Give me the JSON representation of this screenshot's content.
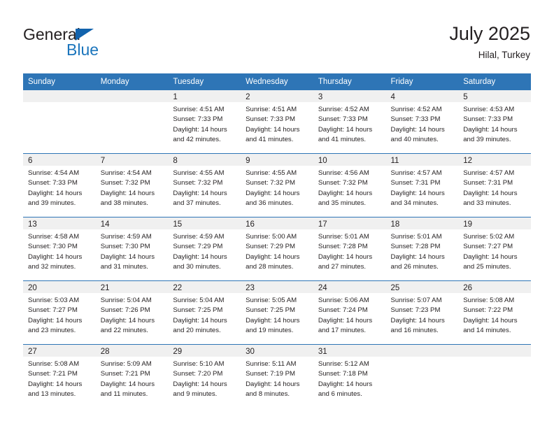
{
  "brand": {
    "line1": "General",
    "line2": "Blue",
    "triangle_color": "#1263ad",
    "blue_color": "#1b75bc"
  },
  "header": {
    "title": "July 2025",
    "location": "Hilal, Turkey"
  },
  "theme": {
    "header_bg": "#2e75b6",
    "header_text": "#ffffff",
    "daynum_bg": "#f0f0f0",
    "text": "#231f20",
    "separator": "#2e75b6"
  },
  "labels": {
    "sunrise": "Sunrise:",
    "sunset": "Sunset:",
    "daylight": "Daylight:"
  },
  "day_headers": [
    "Sunday",
    "Monday",
    "Tuesday",
    "Wednesday",
    "Thursday",
    "Friday",
    "Saturday"
  ],
  "weeks": [
    [
      {
        "day": "",
        "empty": true
      },
      {
        "day": "",
        "empty": true
      },
      {
        "day": "1",
        "sunrise": "Sunrise: 4:51 AM",
        "sunset": "Sunset: 7:33 PM",
        "daylight_l1": "Daylight: 14 hours",
        "daylight_l2": "and 42 minutes."
      },
      {
        "day": "2",
        "sunrise": "Sunrise: 4:51 AM",
        "sunset": "Sunset: 7:33 PM",
        "daylight_l1": "Daylight: 14 hours",
        "daylight_l2": "and 41 minutes."
      },
      {
        "day": "3",
        "sunrise": "Sunrise: 4:52 AM",
        "sunset": "Sunset: 7:33 PM",
        "daylight_l1": "Daylight: 14 hours",
        "daylight_l2": "and 41 minutes."
      },
      {
        "day": "4",
        "sunrise": "Sunrise: 4:52 AM",
        "sunset": "Sunset: 7:33 PM",
        "daylight_l1": "Daylight: 14 hours",
        "daylight_l2": "and 40 minutes."
      },
      {
        "day": "5",
        "sunrise": "Sunrise: 4:53 AM",
        "sunset": "Sunset: 7:33 PM",
        "daylight_l1": "Daylight: 14 hours",
        "daylight_l2": "and 39 minutes."
      }
    ],
    [
      {
        "day": "6",
        "sunrise": "Sunrise: 4:54 AM",
        "sunset": "Sunset: 7:33 PM",
        "daylight_l1": "Daylight: 14 hours",
        "daylight_l2": "and 39 minutes."
      },
      {
        "day": "7",
        "sunrise": "Sunrise: 4:54 AM",
        "sunset": "Sunset: 7:32 PM",
        "daylight_l1": "Daylight: 14 hours",
        "daylight_l2": "and 38 minutes."
      },
      {
        "day": "8",
        "sunrise": "Sunrise: 4:55 AM",
        "sunset": "Sunset: 7:32 PM",
        "daylight_l1": "Daylight: 14 hours",
        "daylight_l2": "and 37 minutes."
      },
      {
        "day": "9",
        "sunrise": "Sunrise: 4:55 AM",
        "sunset": "Sunset: 7:32 PM",
        "daylight_l1": "Daylight: 14 hours",
        "daylight_l2": "and 36 minutes."
      },
      {
        "day": "10",
        "sunrise": "Sunrise: 4:56 AM",
        "sunset": "Sunset: 7:32 PM",
        "daylight_l1": "Daylight: 14 hours",
        "daylight_l2": "and 35 minutes."
      },
      {
        "day": "11",
        "sunrise": "Sunrise: 4:57 AM",
        "sunset": "Sunset: 7:31 PM",
        "daylight_l1": "Daylight: 14 hours",
        "daylight_l2": "and 34 minutes."
      },
      {
        "day": "12",
        "sunrise": "Sunrise: 4:57 AM",
        "sunset": "Sunset: 7:31 PM",
        "daylight_l1": "Daylight: 14 hours",
        "daylight_l2": "and 33 minutes."
      }
    ],
    [
      {
        "day": "13",
        "sunrise": "Sunrise: 4:58 AM",
        "sunset": "Sunset: 7:30 PM",
        "daylight_l1": "Daylight: 14 hours",
        "daylight_l2": "and 32 minutes."
      },
      {
        "day": "14",
        "sunrise": "Sunrise: 4:59 AM",
        "sunset": "Sunset: 7:30 PM",
        "daylight_l1": "Daylight: 14 hours",
        "daylight_l2": "and 31 minutes."
      },
      {
        "day": "15",
        "sunrise": "Sunrise: 4:59 AM",
        "sunset": "Sunset: 7:29 PM",
        "daylight_l1": "Daylight: 14 hours",
        "daylight_l2": "and 30 minutes."
      },
      {
        "day": "16",
        "sunrise": "Sunrise: 5:00 AM",
        "sunset": "Sunset: 7:29 PM",
        "daylight_l1": "Daylight: 14 hours",
        "daylight_l2": "and 28 minutes."
      },
      {
        "day": "17",
        "sunrise": "Sunrise: 5:01 AM",
        "sunset": "Sunset: 7:28 PM",
        "daylight_l1": "Daylight: 14 hours",
        "daylight_l2": "and 27 minutes."
      },
      {
        "day": "18",
        "sunrise": "Sunrise: 5:01 AM",
        "sunset": "Sunset: 7:28 PM",
        "daylight_l1": "Daylight: 14 hours",
        "daylight_l2": "and 26 minutes."
      },
      {
        "day": "19",
        "sunrise": "Sunrise: 5:02 AM",
        "sunset": "Sunset: 7:27 PM",
        "daylight_l1": "Daylight: 14 hours",
        "daylight_l2": "and 25 minutes."
      }
    ],
    [
      {
        "day": "20",
        "sunrise": "Sunrise: 5:03 AM",
        "sunset": "Sunset: 7:27 PM",
        "daylight_l1": "Daylight: 14 hours",
        "daylight_l2": "and 23 minutes."
      },
      {
        "day": "21",
        "sunrise": "Sunrise: 5:04 AM",
        "sunset": "Sunset: 7:26 PM",
        "daylight_l1": "Daylight: 14 hours",
        "daylight_l2": "and 22 minutes."
      },
      {
        "day": "22",
        "sunrise": "Sunrise: 5:04 AM",
        "sunset": "Sunset: 7:25 PM",
        "daylight_l1": "Daylight: 14 hours",
        "daylight_l2": "and 20 minutes."
      },
      {
        "day": "23",
        "sunrise": "Sunrise: 5:05 AM",
        "sunset": "Sunset: 7:25 PM",
        "daylight_l1": "Daylight: 14 hours",
        "daylight_l2": "and 19 minutes."
      },
      {
        "day": "24",
        "sunrise": "Sunrise: 5:06 AM",
        "sunset": "Sunset: 7:24 PM",
        "daylight_l1": "Daylight: 14 hours",
        "daylight_l2": "and 17 minutes."
      },
      {
        "day": "25",
        "sunrise": "Sunrise: 5:07 AM",
        "sunset": "Sunset: 7:23 PM",
        "daylight_l1": "Daylight: 14 hours",
        "daylight_l2": "and 16 minutes."
      },
      {
        "day": "26",
        "sunrise": "Sunrise: 5:08 AM",
        "sunset": "Sunset: 7:22 PM",
        "daylight_l1": "Daylight: 14 hours",
        "daylight_l2": "and 14 minutes."
      }
    ],
    [
      {
        "day": "27",
        "sunrise": "Sunrise: 5:08 AM",
        "sunset": "Sunset: 7:21 PM",
        "daylight_l1": "Daylight: 14 hours",
        "daylight_l2": "and 13 minutes."
      },
      {
        "day": "28",
        "sunrise": "Sunrise: 5:09 AM",
        "sunset": "Sunset: 7:21 PM",
        "daylight_l1": "Daylight: 14 hours",
        "daylight_l2": "and 11 minutes."
      },
      {
        "day": "29",
        "sunrise": "Sunrise: 5:10 AM",
        "sunset": "Sunset: 7:20 PM",
        "daylight_l1": "Daylight: 14 hours",
        "daylight_l2": "and 9 minutes."
      },
      {
        "day": "30",
        "sunrise": "Sunrise: 5:11 AM",
        "sunset": "Sunset: 7:19 PM",
        "daylight_l1": "Daylight: 14 hours",
        "daylight_l2": "and 8 minutes."
      },
      {
        "day": "31",
        "sunrise": "Sunrise: 5:12 AM",
        "sunset": "Sunset: 7:18 PM",
        "daylight_l1": "Daylight: 14 hours",
        "daylight_l2": "and 6 minutes."
      },
      {
        "day": "",
        "empty": true
      },
      {
        "day": "",
        "empty": true
      }
    ]
  ]
}
